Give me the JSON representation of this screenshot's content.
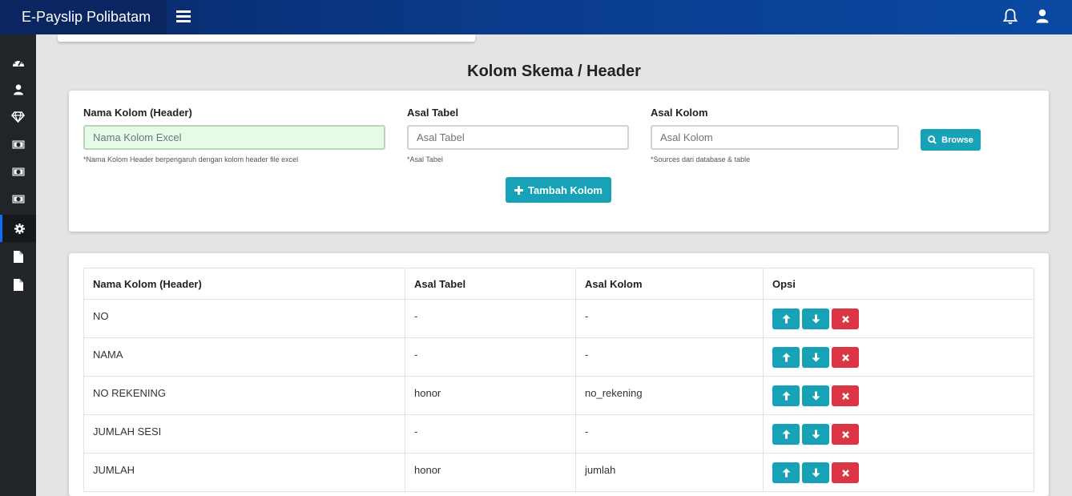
{
  "app": {
    "title": "E-Payslip Polibatam"
  },
  "header_icons": [
    "menu-icon",
    "bell-icon",
    "user-icon"
  ],
  "sidebar": {
    "items": [
      {
        "icon": "dashboard-icon",
        "active": false
      },
      {
        "icon": "user-icon",
        "active": false
      },
      {
        "icon": "diamond-icon",
        "active": false
      },
      {
        "icon": "money-icon",
        "active": false
      },
      {
        "icon": "money-icon",
        "active": false
      },
      {
        "icon": "money-icon",
        "active": false
      },
      {
        "icon": "gear-icon",
        "active": true
      },
      {
        "icon": "file-icon",
        "active": false
      },
      {
        "icon": "file-icon",
        "active": false
      }
    ]
  },
  "page": {
    "title": "Kolom Skema / Header"
  },
  "form": {
    "nama_kolom": {
      "label": "Nama Kolom (Header)",
      "placeholder": "Nama Kolom Excel",
      "value": "",
      "help": "*Nama Kolom Header berpengaruh dengan kolom header file excel"
    },
    "asal_tabel": {
      "label": "Asal Tabel",
      "placeholder": "Asal Tabel",
      "value": "",
      "help": "*Asal Tabel"
    },
    "asal_kolom": {
      "label": "Asal Kolom",
      "placeholder": "Asal Kolom",
      "value": "",
      "help": "*Sources dari database & table"
    },
    "browse_label": "Browse",
    "add_label": "Tambah Kolom"
  },
  "table": {
    "headers": [
      "Nama Kolom (Header)",
      "Asal Tabel",
      "Asal Kolom",
      "Opsi"
    ],
    "rows": [
      {
        "nama": "NO",
        "tabel": "-",
        "kolom": "-"
      },
      {
        "nama": "NAMA",
        "tabel": "-",
        "kolom": "-"
      },
      {
        "nama": "NO REKENING",
        "tabel": "honor",
        "kolom": "no_rekening"
      },
      {
        "nama": "JUMLAH SESI",
        "tabel": "-",
        "kolom": "-"
      },
      {
        "nama": "JUMLAH",
        "tabel": "honor",
        "kolom": "jumlah"
      }
    ],
    "row_actions": [
      "arrow-up-icon",
      "arrow-down-icon",
      "close-icon"
    ]
  },
  "colors": {
    "navbar": "#0a3a8a",
    "sidebar": "#212529",
    "info": "#17a2b8",
    "danger": "#dc3545"
  }
}
